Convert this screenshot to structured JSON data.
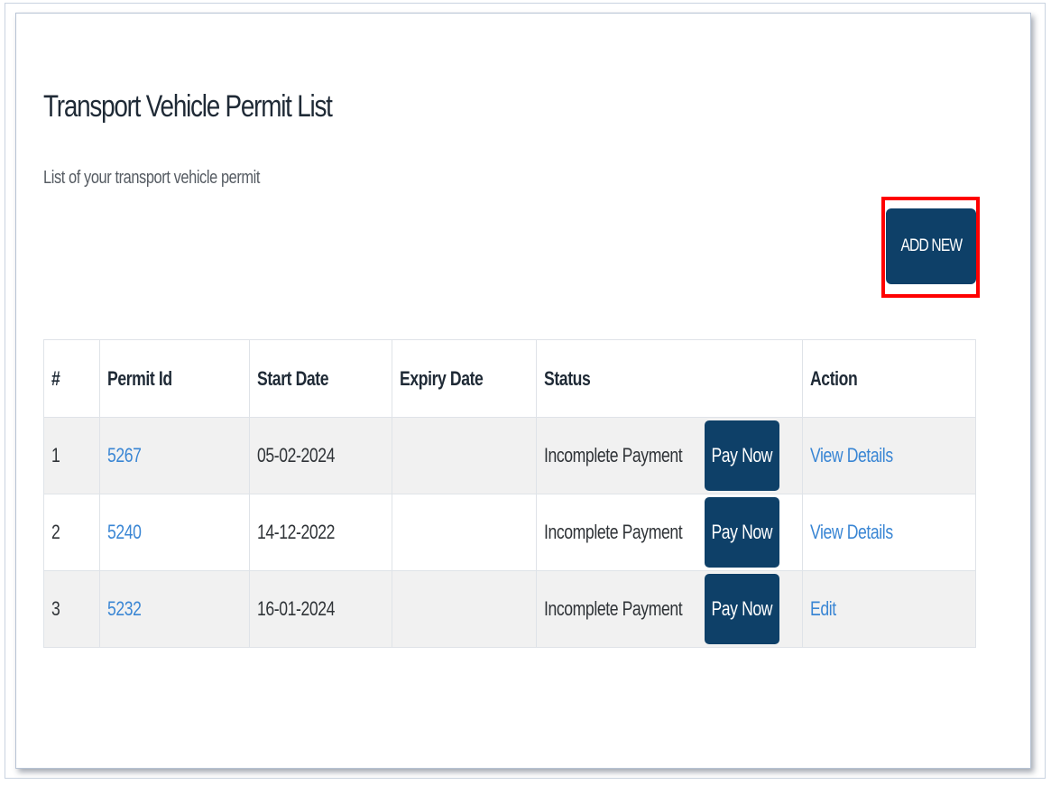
{
  "page": {
    "title": "Transport Vehicle Permit List",
    "subtitle": "List of your transport vehicle permit"
  },
  "toolbar": {
    "add_new_label": "ADD NEW"
  },
  "table": {
    "headers": [
      "#",
      "Permit Id",
      "Start Date",
      "Expiry Date",
      "Status",
      "Action"
    ],
    "rows": [
      {
        "index": "1",
        "permit_id": "5267",
        "start_date": "05-02-2024",
        "expiry_date": "",
        "status": "Incomplete Payment",
        "pay_label": "Pay Now",
        "action": "View Details"
      },
      {
        "index": "2",
        "permit_id": "5240",
        "start_date": "14-12-2022",
        "expiry_date": "",
        "status": "Incomplete Payment",
        "pay_label": "Pay Now",
        "action": "View Details"
      },
      {
        "index": "3",
        "permit_id": "5232",
        "start_date": "16-01-2024",
        "expiry_date": "",
        "status": "Incomplete Payment",
        "pay_label": "Pay Now",
        "action": "Edit"
      }
    ]
  },
  "colors": {
    "primary_button": "#0e4068",
    "link": "#3a86d4",
    "highlight": "#ff0000"
  }
}
